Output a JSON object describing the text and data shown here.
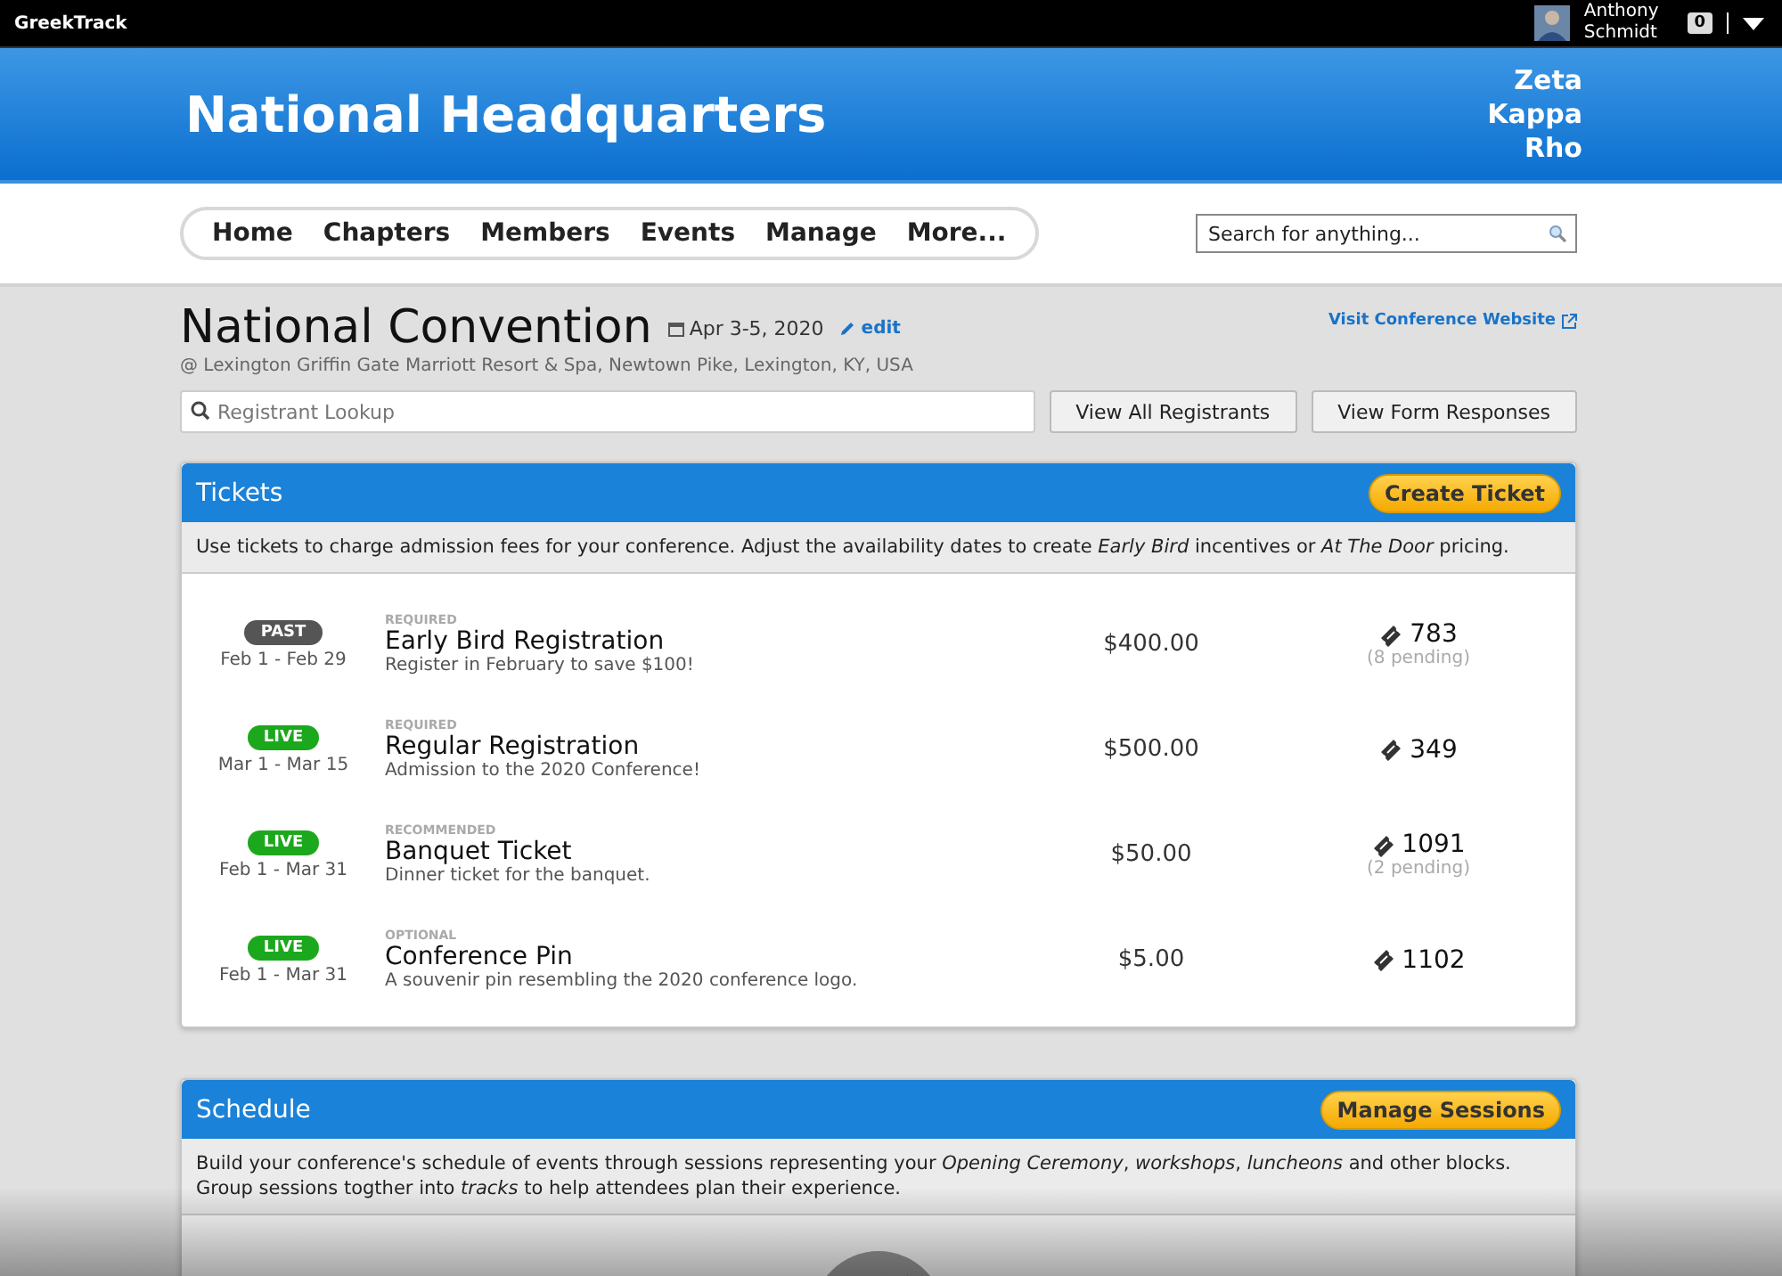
{
  "topbar": {
    "app_name": "GreekTrack",
    "user_first": "Anthony",
    "user_last": "Schmidt",
    "notifications": "0"
  },
  "header": {
    "title": "National Headquarters",
    "org_lines": [
      "Zeta",
      "Kappa",
      "Rho"
    ]
  },
  "nav": {
    "items": [
      "Home",
      "Chapters",
      "Members",
      "Events",
      "Manage",
      "More..."
    ],
    "search_placeholder": "Search for anything..."
  },
  "event": {
    "title": "National Convention",
    "date": "Apr 3-5, 2020",
    "edit_label": "edit",
    "website_link": "Visit Conference Website",
    "location": "@ Lexington Griffin Gate Marriott Resort & Spa, Newtown Pike, Lexington, KY, USA",
    "lookup_placeholder": "Registrant Lookup",
    "buttons": [
      "View All Registrants",
      "View Form Responses"
    ]
  },
  "tickets": {
    "title": "Tickets",
    "action": "Create Ticket",
    "description": "Use tickets to charge admission fees for your conference. Adjust the availability dates to create *Early Bird* incentives or *At The Door* pricing.",
    "rows": [
      {
        "status": {
          "kind": "past",
          "label": "PAST"
        },
        "dates": "Feb 1 - Feb 29",
        "tag": "REQUIRED",
        "name": "Early Bird Registration",
        "detail": "Register in February to save $100!",
        "price": "$400.00",
        "count": "783",
        "pending": "(8 pending)"
      },
      {
        "status": {
          "kind": "live",
          "label": "LIVE"
        },
        "dates": "Mar 1 - Mar 15",
        "tag": "REQUIRED",
        "name": "Regular Registration",
        "detail": "Admission to the 2020 Conference!",
        "price": "$500.00",
        "count": "349"
      },
      {
        "status": {
          "kind": "live",
          "label": "LIVE"
        },
        "dates": "Feb 1 - Mar 31",
        "tag": "RECOMMENDED",
        "name": "Banquet Ticket",
        "detail": "Dinner ticket for the banquet.",
        "price": "$50.00",
        "count": "1091",
        "pending": "(2 pending)"
      },
      {
        "status": {
          "kind": "live",
          "label": "LIVE"
        },
        "dates": "Feb 1 - Mar 31",
        "tag": "OPTIONAL",
        "name": "Conference Pin",
        "detail": "A souvenir pin resembling the 2020 conference logo.",
        "price": "$5.00",
        "count": "1102"
      }
    ]
  },
  "schedule": {
    "title": "Schedule",
    "action": "Manage Sessions",
    "description": "Build your conference's schedule of events through sessions representing your *Opening Ceremony*, *workshops*, *luncheons* and other blocks. Group sessions togther into *tracks* to help attendees plan their experience."
  }
}
